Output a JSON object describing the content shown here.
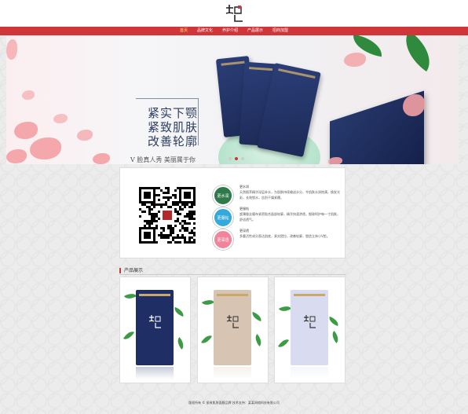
{
  "header": {
    "nav": [
      {
        "label": "首页",
        "active": true
      },
      {
        "label": "品牌文化",
        "active": false
      },
      {
        "label": "养护介绍",
        "active": false
      },
      {
        "label": "产品展示",
        "active": false
      },
      {
        "label": "招商加盟",
        "active": false
      }
    ]
  },
  "banner": {
    "slogan_lines": [
      "紧实下颚",
      "紧致肌肤",
      "改善轮廓"
    ],
    "tagline": "V 脸真人秀  美丽属于你",
    "slide_count": 3,
    "active_slide": 2
  },
  "info": {
    "features": [
      {
        "badge": "更水润",
        "color": "#2f7a4b",
        "title": "更水润",
        "text": "天然植萃精华深层补水，为肌肤持续输送水分，令肌肤水润饱满，焕发光彩，长效锁水，告别干燥紧绷。"
      },
      {
        "badge": "更服帖",
        "color": "#35a9d9",
        "title": "更服帖",
        "text": "超薄蚕丝膜布紧密贴合面部轮廓，精华快速渗透，细致呵护每一寸肌肤，舒适透气。"
      },
      {
        "badge": "更深透",
        "color": "#f0849a",
        "title": "更深透",
        "text": "多重活性成分直达肌底，紧实提拉，改善轮廓，塑造立体小V脸。"
      }
    ]
  },
  "products": {
    "title": "产品展示",
    "items": [
      {
        "name": "product-dark-blue",
        "color": "#1f2f66"
      },
      {
        "name": "product-beige",
        "color": "#d8c4b3"
      },
      {
        "name": "product-lavender",
        "color": "#d9dcf0"
      }
    ]
  },
  "footer": {
    "text": "版权所有 © 紧致肌肤面膜品牌  技术支持：某某网络科技有限公司"
  },
  "colors": {
    "brand_red": "#d0353a",
    "navy": "#1f2f66"
  }
}
